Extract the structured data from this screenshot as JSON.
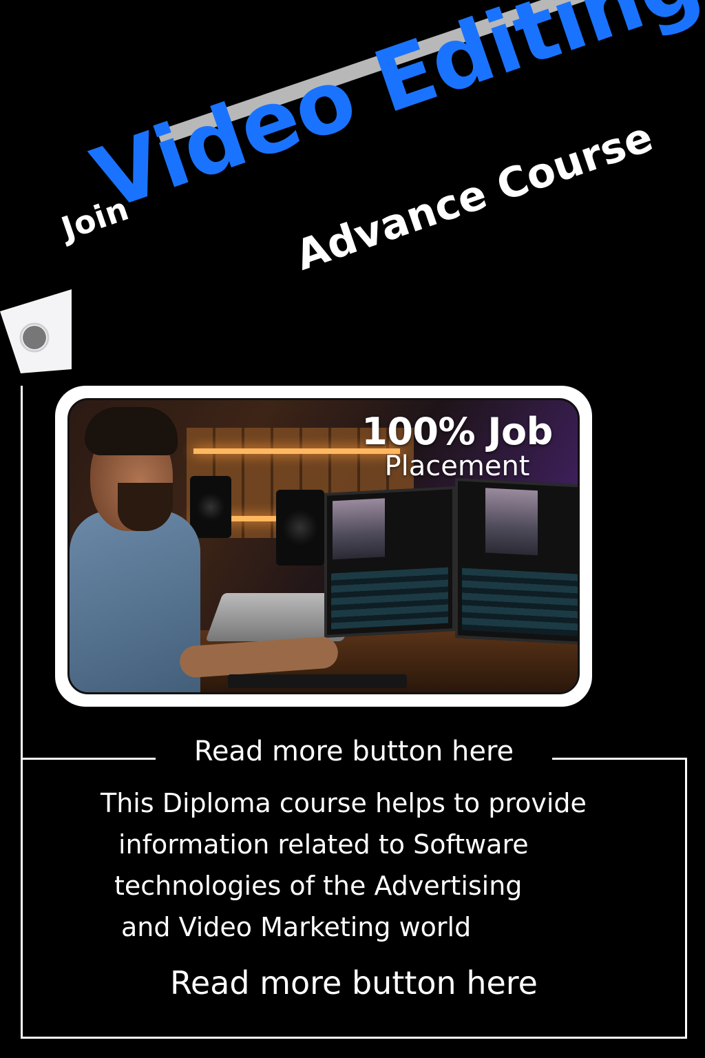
{
  "headline": {
    "join": "Join",
    "title": "Video Editing",
    "subtitle": "Advance Course"
  },
  "badge": {
    "line1": "100% Job",
    "line2": "Placement"
  },
  "cta": {
    "top_label": "Read more button here",
    "bottom_label": "Read more button here"
  },
  "description": {
    "lines": [
      "This Diploma course helps to provide",
      "information related to Software",
      "technologies of the Advertising",
      "and Video Marketing world"
    ]
  },
  "colors": {
    "background": "#000000",
    "accent": "#1a73ff",
    "text": "#ffffff",
    "bar": "#b8b8b8"
  },
  "icons": {
    "tag": "tag-icon"
  }
}
